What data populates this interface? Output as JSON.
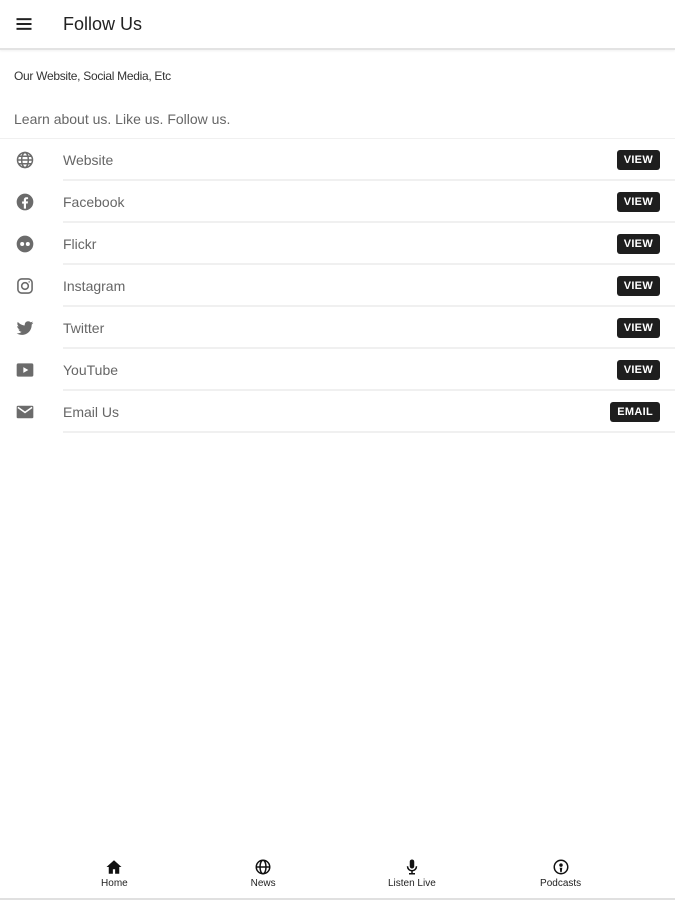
{
  "appbar": {
    "title": "Follow Us",
    "menu_icon": "menu-icon"
  },
  "section": {
    "subtitle": "Our Website, Social Media, Etc",
    "description": "Learn about us. Like us. Follow us."
  },
  "links": [
    {
      "label": "Website",
      "icon": "globe-icon",
      "action": "VIEW"
    },
    {
      "label": "Facebook",
      "icon": "facebook-icon",
      "action": "VIEW"
    },
    {
      "label": "Flickr",
      "icon": "flickr-icon",
      "action": "VIEW"
    },
    {
      "label": "Instagram",
      "icon": "instagram-icon",
      "action": "VIEW"
    },
    {
      "label": "Twitter",
      "icon": "twitter-icon",
      "action": "VIEW"
    },
    {
      "label": "YouTube",
      "icon": "youtube-icon",
      "action": "VIEW"
    },
    {
      "label": "Email Us",
      "icon": "email-icon",
      "action": "EMAIL"
    }
  ],
  "bottom_nav": [
    {
      "label": "Home",
      "icon": "home-icon"
    },
    {
      "label": "News",
      "icon": "globe-icon"
    },
    {
      "label": "Listen Live",
      "icon": "microphone-icon"
    },
    {
      "label": "Podcasts",
      "icon": "podcast-icon"
    }
  ],
  "colors": {
    "button_bg": "#1e1e1e",
    "icon_color": "#6b6b6b",
    "divider": "#f0f0f0"
  }
}
